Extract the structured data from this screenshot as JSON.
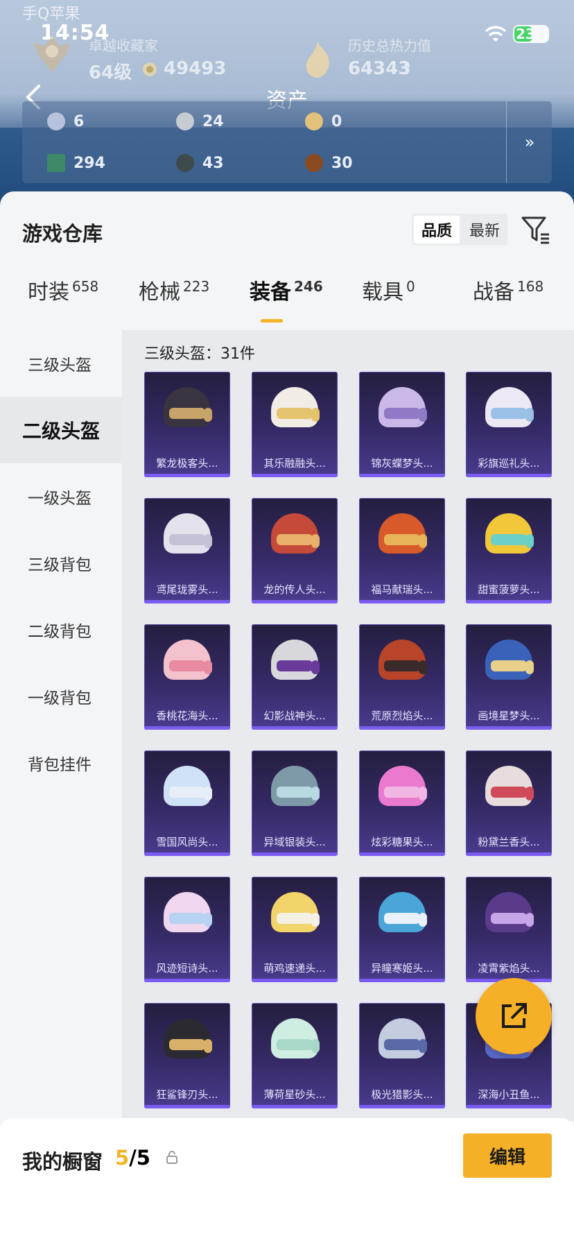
{
  "status": {
    "carrier": "手Q苹果",
    "time": "14:54",
    "battery": "23"
  },
  "header": {
    "collector_label": "卓越收藏家",
    "level": "64级",
    "points": "49493",
    "heat_label": "历史总热力值",
    "heat_value": "64343",
    "heat_help": "?",
    "title": "资产",
    "assets": [
      {
        "icon": "gem-icon",
        "value": "6",
        "color": "#b7c3dc"
      },
      {
        "icon": "silver-coin-icon",
        "value": "24",
        "color": "#c7ccd3"
      },
      {
        "icon": "gold-coin-icon",
        "value": "0",
        "color": "#e2c27a"
      },
      {
        "icon": "card-icon",
        "value": "294",
        "color": "#3e8a68"
      },
      {
        "icon": "dark-coin-icon",
        "value": "43",
        "color": "#3e4a4c"
      },
      {
        "icon": "bronze-coin-icon",
        "value": "30",
        "color": "#8c4a22"
      }
    ],
    "more": "»"
  },
  "warehouse": {
    "title": "游戏仓库",
    "sort": [
      "品质",
      "最新"
    ],
    "tabs": [
      {
        "label": "时装",
        "count": "658"
      },
      {
        "label": "枪械",
        "count": "223"
      },
      {
        "label": "装备",
        "count": "246"
      },
      {
        "label": "载具",
        "count": "0"
      },
      {
        "label": "战备",
        "count": "168"
      }
    ],
    "categories": [
      "三级头盔",
      "二级头盔",
      "一级头盔",
      "三级背包",
      "二级背包",
      "一级背包",
      "背包挂件"
    ],
    "section_header": "三级头盔：31件",
    "items": [
      {
        "name": "繁龙极客头...",
        "dome": "#3a3440",
        "visor": "#c8a46a"
      },
      {
        "name": "其乐融融头...",
        "dome": "#f1ece4",
        "visor": "#e6c46e"
      },
      {
        "name": "锦灰蝶梦头...",
        "dome": "#c9b8e8",
        "visor": "#8e7ac6"
      },
      {
        "name": "彩旗巡礼头...",
        "dome": "#ece8f4",
        "visor": "#9ac0e8"
      },
      {
        "name": "鸢尾珑雾头...",
        "dome": "#e4e2ec",
        "visor": "#c6c2d6"
      },
      {
        "name": "龙的传人头...",
        "dome": "#c64a3a",
        "visor": "#e8b06a"
      },
      {
        "name": "福马献瑞头...",
        "dome": "#d85a2a",
        "visor": "#e8b45a"
      },
      {
        "name": "甜蜜菠萝头...",
        "dome": "#f2c83a",
        "visor": "#6ad0c8"
      },
      {
        "name": "香桃花海头...",
        "dome": "#f4c2cc",
        "visor": "#e88aa0"
      },
      {
        "name": "幻影战神头...",
        "dome": "#d8d8dc",
        "visor": "#6a3a9a"
      },
      {
        "name": "荒原烈焰头...",
        "dome": "#b8442a",
        "visor": "#3a2a2a"
      },
      {
        "name": "画境星梦头...",
        "dome": "#3a62b8",
        "visor": "#e8d08a"
      },
      {
        "name": "雪国风尚头...",
        "dome": "#cfe2f6",
        "visor": "#e8eef8"
      },
      {
        "name": "异域银装头...",
        "dome": "#7e9aa8",
        "visor": "#b8d8e2"
      },
      {
        "name": "炫彩糖果头...",
        "dome": "#ea7ad0",
        "visor": "#f2b6e4"
      },
      {
        "name": "粉黛兰香头...",
        "dome": "#e8dcdc",
        "visor": "#d04a5a"
      },
      {
        "name": "风迹短诗头...",
        "dome": "#f0d6ee",
        "visor": "#b8d2f2"
      },
      {
        "name": "萌鸡速递头...",
        "dome": "#f2d46a",
        "visor": "#f4f0e4"
      },
      {
        "name": "异瞳寒姬头...",
        "dome": "#4aa6d8",
        "visor": "#e8f0f8"
      },
      {
        "name": "凌霄紫焰头...",
        "dome": "#5a3a8a",
        "visor": "#c8a4e8"
      },
      {
        "name": "狂鲨锋刃头...",
        "dome": "#2a2a30",
        "visor": "#d8b06a"
      },
      {
        "name": "薄荷星砂头...",
        "dome": "#cfeee2",
        "visor": "#a8d8c8"
      },
      {
        "name": "极光猎影头...",
        "dome": "#c4cce0",
        "visor": "#5a6aa8"
      },
      {
        "name": "深海小丑鱼...",
        "dome": "#5a6ac8",
        "visor": "#e8884a"
      }
    ]
  },
  "showcase": {
    "title": "我的橱窗",
    "used": "5",
    "sep": "/",
    "total": "5",
    "edit": "编辑"
  },
  "fab": {
    "icon": "share-icon"
  }
}
